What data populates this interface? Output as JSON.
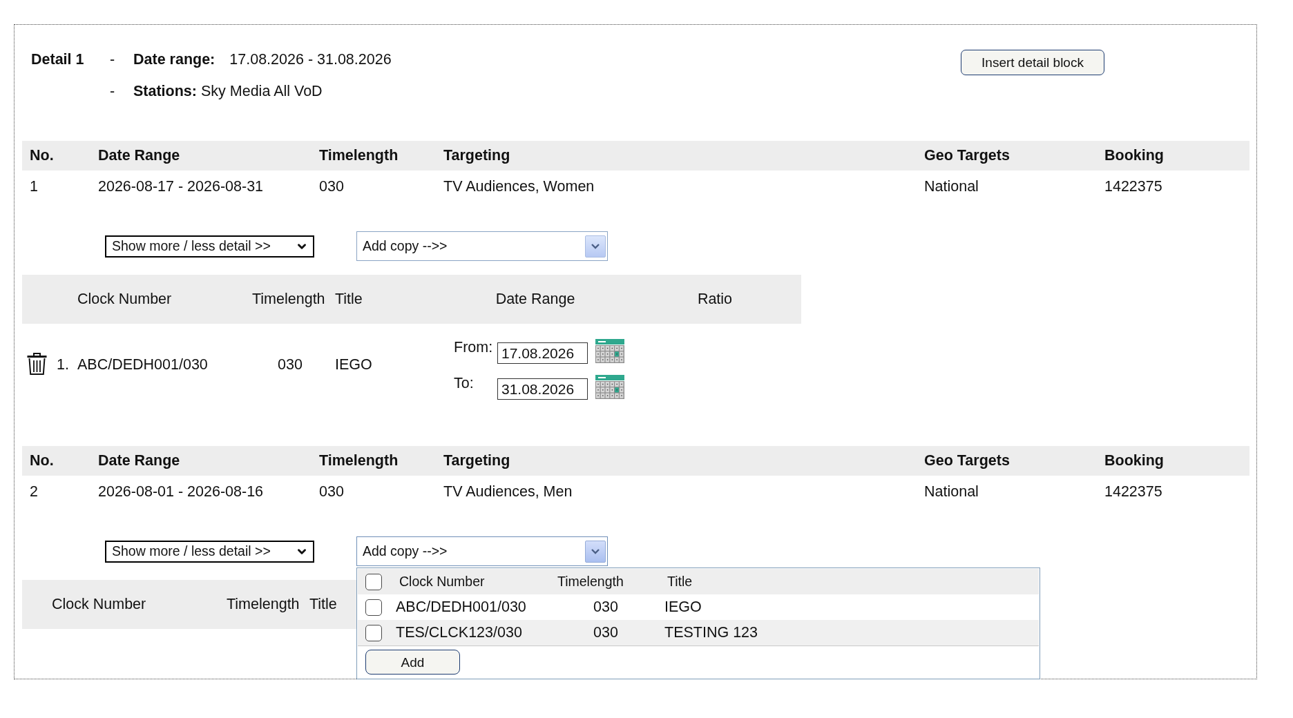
{
  "detail": {
    "title": "Detail 1",
    "date_range": {
      "separator": "-",
      "label": "Date range:",
      "value": "17.08.2026 - 31.08.2026"
    },
    "stations": {
      "separator": "-",
      "label": "Stations:",
      "value": "Sky Media All VoD"
    }
  },
  "insert_button": "Insert detail block",
  "lines": [
    {
      "columns": [
        "No.",
        "Date Range",
        "Timelength",
        "Targeting",
        "Geo Targets",
        "Booking"
      ],
      "row": [
        "1",
        "2026-08-17 - 2026-08-31",
        "030",
        "TV Audiences, Women",
        "National",
        "1422375"
      ],
      "detail_select": "Show more / less detail >>",
      "copy_select": {
        "value": "Add copy -->>",
        "expanded": false
      },
      "copies": {
        "columns": [
          "Clock Number",
          "Timelength",
          "Title",
          "Date Range",
          "Ratio"
        ],
        "rows": [
          {
            "index": "1.",
            "clock_number": "ABC/DEDH001/030",
            "timelength": "030",
            "title": "IEGO",
            "from": {
              "label": "From:",
              "value": "17.08.2026"
            },
            "to": {
              "label": "To:",
              "value": "31.08.2026"
            }
          }
        ]
      }
    },
    {
      "columns": [
        "No.",
        "Date Range",
        "Timelength",
        "Targeting",
        "Geo Targets",
        "Booking"
      ],
      "row": [
        "2",
        "2026-08-01 - 2026-08-16",
        "030",
        "TV Audiences, Men",
        "National",
        "1422375"
      ],
      "detail_select": "Show more / less detail >>",
      "copy_select": {
        "value": "Add copy -->>",
        "expanded": true,
        "dropdown": {
          "select_all_checked": false,
          "columns": [
            "Clock Number",
            "Timelength",
            "Title"
          ],
          "options": [
            {
              "clock_number": "ABC/DEDH001/030",
              "timelength": "030",
              "title": "IEGO",
              "checked": false
            },
            {
              "clock_number": "TES/CLCK123/030",
              "timelength": "030",
              "title": "TESTING 123",
              "checked": false
            }
          ],
          "button": "Add"
        }
      },
      "copies": {
        "columns": [
          "Clock Number",
          "Timelength",
          "Title"
        ]
      }
    }
  ]
}
